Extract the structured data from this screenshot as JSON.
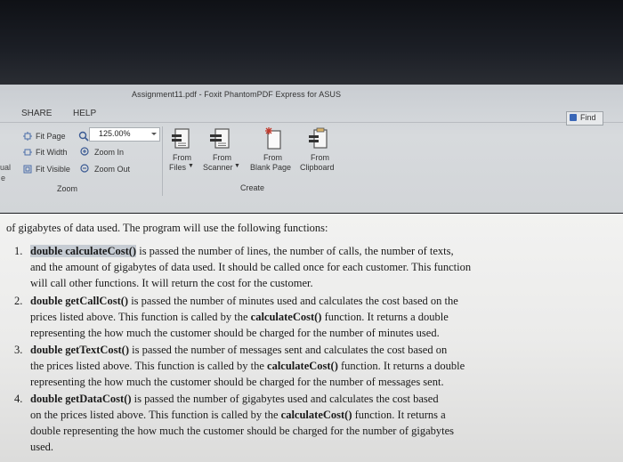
{
  "app": {
    "title": "Assignment11.pdf - Foxit PhantomPDF Express for ASUS",
    "menu": [
      "SHARE",
      "HELP"
    ],
    "find_label": "Find"
  },
  "ribbon": {
    "fit_page": "Fit Page",
    "fit_width": "Fit Width",
    "fit_visible": "Fit Visible",
    "zoom_value": "125.00%",
    "zoom_in": "Zoom In",
    "zoom_out": "Zoom Out",
    "zoom_group": "Zoom",
    "create_buttons": [
      {
        "line1": "From",
        "line2": "Files"
      },
      {
        "line1": "From",
        "line2": "Scanner"
      },
      {
        "line1": "From",
        "line2": "Blank Page"
      },
      {
        "line1": "From",
        "line2": "Clipboard"
      }
    ],
    "create_group": "Create",
    "left_edge": [
      "ual",
      "e"
    ]
  },
  "document": {
    "intro": "of gigabytes of data used. The program will use the following functions:",
    "items": [
      {
        "num": "1.",
        "lines": [
          {
            "bold": "double calculateCost()",
            "rest": " is passed the number of lines, the number of calls, the number of texts,"
          },
          {
            "text": "and the amount of gigabytes of data used. It should be called once for each customer. This function"
          },
          {
            "text": "will call other functions. It will return the cost for the customer."
          }
        ]
      },
      {
        "num": "2.",
        "lines": [
          {
            "bold": "double getCallCost()",
            "rest": " is passed the number of minutes used and calculates the cost based on the"
          },
          {
            "pre": "prices listed above. This function is called by the ",
            "bold": "calculateCost()",
            "post": " function. It returns a double"
          },
          {
            "text": "representing the how much the customer should be charged for the number of minutes used."
          }
        ]
      },
      {
        "num": "3.",
        "lines": [
          {
            "bold": "double getTextCost()",
            "rest": " is passed the number of messages sent and calculates the cost based on"
          },
          {
            "pre": "the prices listed above. This function is called by the ",
            "bold": "calculateCost()",
            "post": " function. It returns a double"
          },
          {
            "text": "representing the how much the customer should be charged for the number of messages sent."
          }
        ]
      },
      {
        "num": "4.",
        "lines": [
          {
            "bold": "double getDataCost()",
            "rest": " is passed the number of gigabytes used and calculates the cost based"
          },
          {
            "pre": "on the prices listed above. This function is called by the ",
            "bold": "calculateCost()",
            "post": " function. It returns a"
          },
          {
            "text": "double representing the how much the customer should be charged for the number of gigabytes"
          },
          {
            "text": "used."
          }
        ]
      }
    ]
  }
}
